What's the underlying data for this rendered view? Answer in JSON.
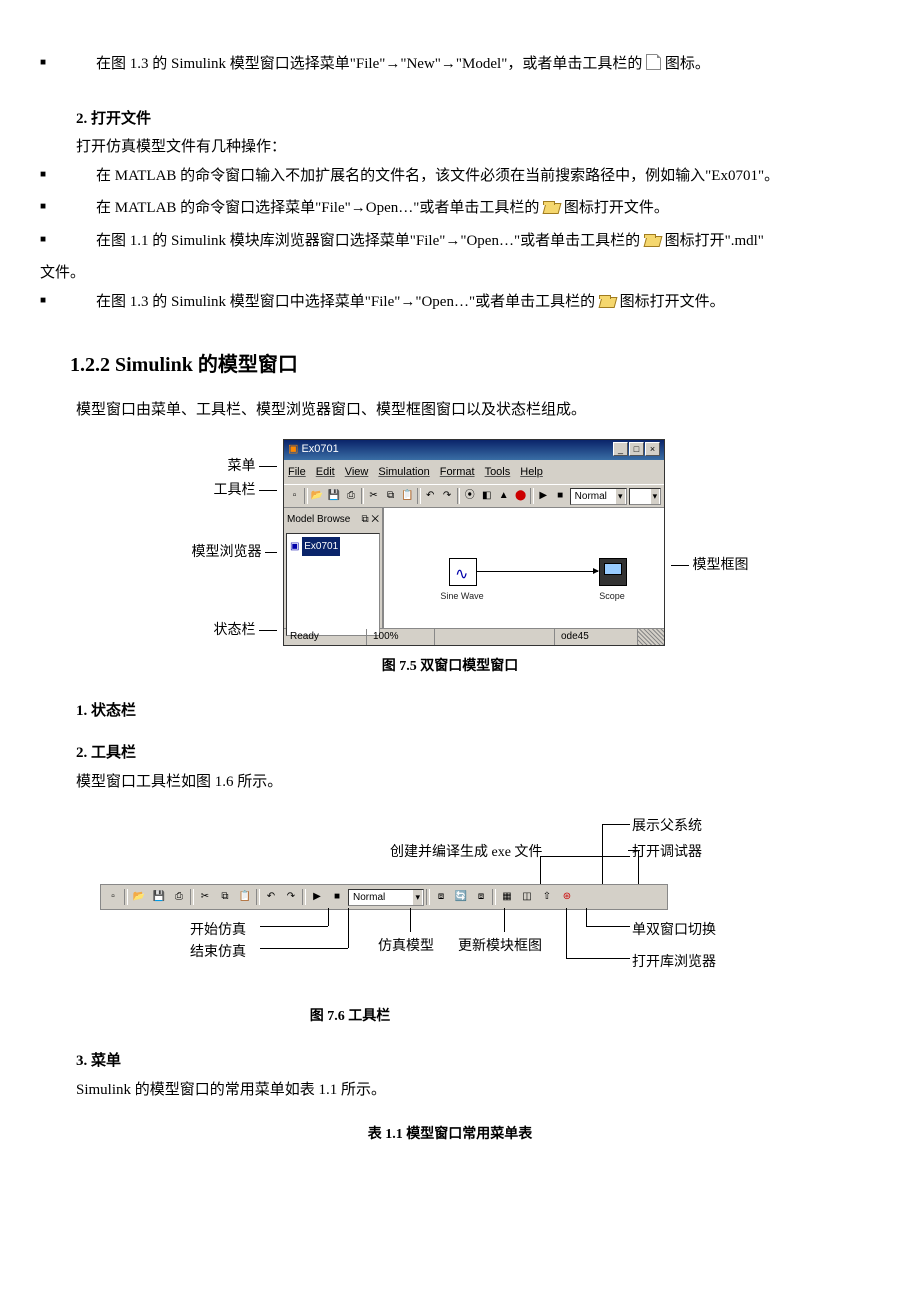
{
  "bullets": {
    "b1": "在图 1.3 的 Simulink 模型窗口选择菜单\"File\"→\"New\"→\"Model\"，或者单击工具栏的",
    "b1_tail": "图标。",
    "b2": "在 MATLAB 的命令窗口输入不加扩展名的文件名，该文件必须在当前搜索路径中，例如输入\"Ex0701\"。",
    "b3": "在 MATLAB 的命令窗口选择菜单\"File\"→Open…\"或者单击工具栏的",
    "b3_tail": "图标打开文件。",
    "b4": "在图 1.1 的 Simulink 模块库浏览器窗口选择菜单\"File\"→\"Open…\"或者单击工具栏的",
    "b4_tail": "图标打开\".mdl\"",
    "b4_cont": "文件。",
    "b5": "在图 1.3 的 Simulink 模型窗口中选择菜单\"File\"→\"Open…\"或者单击工具栏的",
    "b5_tail": "图标打开文件。"
  },
  "headings": {
    "openfile_num": "2.",
    "openfile": "打开文件",
    "openfile_desc": "打开仿真模型文件有几种操作：",
    "section": "1.2.2 Simulink 的模型窗口",
    "section_desc": "模型窗口由菜单、工具栏、模型浏览器窗口、模型框图窗口以及状态栏组成。",
    "status_num": "1.",
    "status": "状态栏",
    "tool_num": "2.",
    "tool": "工具栏",
    "tool_desc": "模型窗口工具栏如图 1.6 所示。",
    "menu_num": "3.",
    "menu": "菜单",
    "menu_desc": "Simulink 的模型窗口的常用菜单如表 1.1 所示。"
  },
  "fig75": {
    "caption": "图 7.5  双窗口模型窗口",
    "labels": {
      "menu": "菜单",
      "toolbar": "工具栏",
      "browser": "模型浏览器",
      "status": "状态栏",
      "canvas": "模型框图"
    },
    "window": {
      "title": "Ex0701",
      "menubar": [
        "File",
        "Edit",
        "View",
        "Simulation",
        "Format",
        "Tools",
        "Help"
      ],
      "combo": "Normal",
      "mb_title": "Model Browse",
      "tree_node": "Ex0701",
      "sine": "Sine Wave",
      "scope": "Scope",
      "status_ready": "Ready",
      "status_zoom": "100%",
      "status_solver": "ode45"
    }
  },
  "fig76": {
    "caption": "图 7.6  工具栏",
    "labels": {
      "build_exe": "创建并编译生成 exe 文件",
      "parent": "展示父系统",
      "debugger": "打开调试器",
      "start": "开始仿真",
      "stop": "结束仿真",
      "simmodel": "仿真模型",
      "update": "更新模块框图",
      "toggle": "单双窗口切换",
      "libbrowser": "打开库浏览器"
    },
    "combo": "Normal"
  },
  "table_caption": "表 1.1 模型窗口常用菜单表"
}
